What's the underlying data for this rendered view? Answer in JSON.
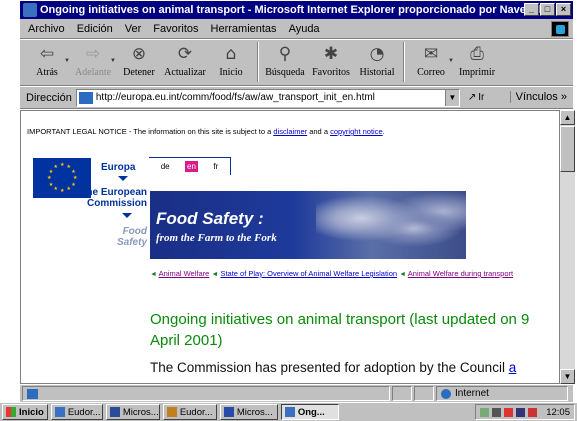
{
  "window": {
    "title": "Ongoing initiatives on animal transport - Microsoft Internet Explorer proporcionado por Navegalia",
    "controls": {
      "minimize": "_",
      "maximize": "□",
      "close": "×"
    }
  },
  "menu": [
    "Archivo",
    "Edición",
    "Ver",
    "Favoritos",
    "Herramientas",
    "Ayuda"
  ],
  "toolbar": [
    {
      "label": "Atrás",
      "icon": "back-arrow-icon",
      "glyph": "⇦",
      "disabled": false
    },
    {
      "label": "Adelante",
      "icon": "forward-arrow-icon",
      "glyph": "⇨",
      "disabled": true
    },
    {
      "label": "Detener",
      "icon": "stop-icon",
      "glyph": "⊗"
    },
    {
      "label": "Actualizar",
      "icon": "refresh-icon",
      "glyph": "⟳"
    },
    {
      "label": "Inicio",
      "icon": "home-icon",
      "glyph": "⌂"
    },
    {
      "label": "Búsqueda",
      "icon": "search-icon",
      "glyph": "⚲"
    },
    {
      "label": "Favoritos",
      "icon": "favorites-icon",
      "glyph": "✱"
    },
    {
      "label": "Historial",
      "icon": "history-icon",
      "glyph": "◔"
    },
    {
      "label": "Correo",
      "icon": "mail-icon",
      "glyph": "✉"
    },
    {
      "label": "Imprimir",
      "icon": "print-icon",
      "glyph": "⎙"
    }
  ],
  "address": {
    "label": "Dirección",
    "url": "http://europa.eu.int/comm/food/fs/aw/aw_transport_init_en.html",
    "go": "Ir",
    "links": "Vínculos"
  },
  "page": {
    "legal_prefix": "IMPORTANT LEGAL NOTICE - The information on this site is subject to a",
    "legal_link1": "disclaimer",
    "legal_mid": "and a",
    "legal_link2": "copyright notice",
    "legal_suffix": ".",
    "europa": "Europa",
    "commission_line1": "The European",
    "commission_line2": "Commission",
    "food_line1": "Food",
    "food_line2": "Safety",
    "langs": [
      "de",
      "en",
      "fr"
    ],
    "banner_title": "Food Safety :",
    "banner_sub": "from the Farm to the Fork",
    "crumb1": "Animal Welfare",
    "crumb2": "State of Play: Overview of Animal Welfare Legislation",
    "crumb3": "Animal Welfare during transport",
    "heading": "Ongoing initiatives on animal transport (last updated on 9 April 2001)",
    "body_text": "The Commission has presented for adoption by the Council",
    "body_link": "a"
  },
  "status": {
    "zone": "Internet"
  },
  "taskbar": {
    "start": "Inicio",
    "tasks": [
      "Eudor...",
      "Micros...",
      "Eudor...",
      "Micros...",
      "Ong..."
    ],
    "time": "12:05"
  },
  "colors": {
    "title_bar": "#000080",
    "heading_green": "#0a8a0a",
    "eu_blue": "#003399",
    "lang_active": "#d81b8a"
  }
}
